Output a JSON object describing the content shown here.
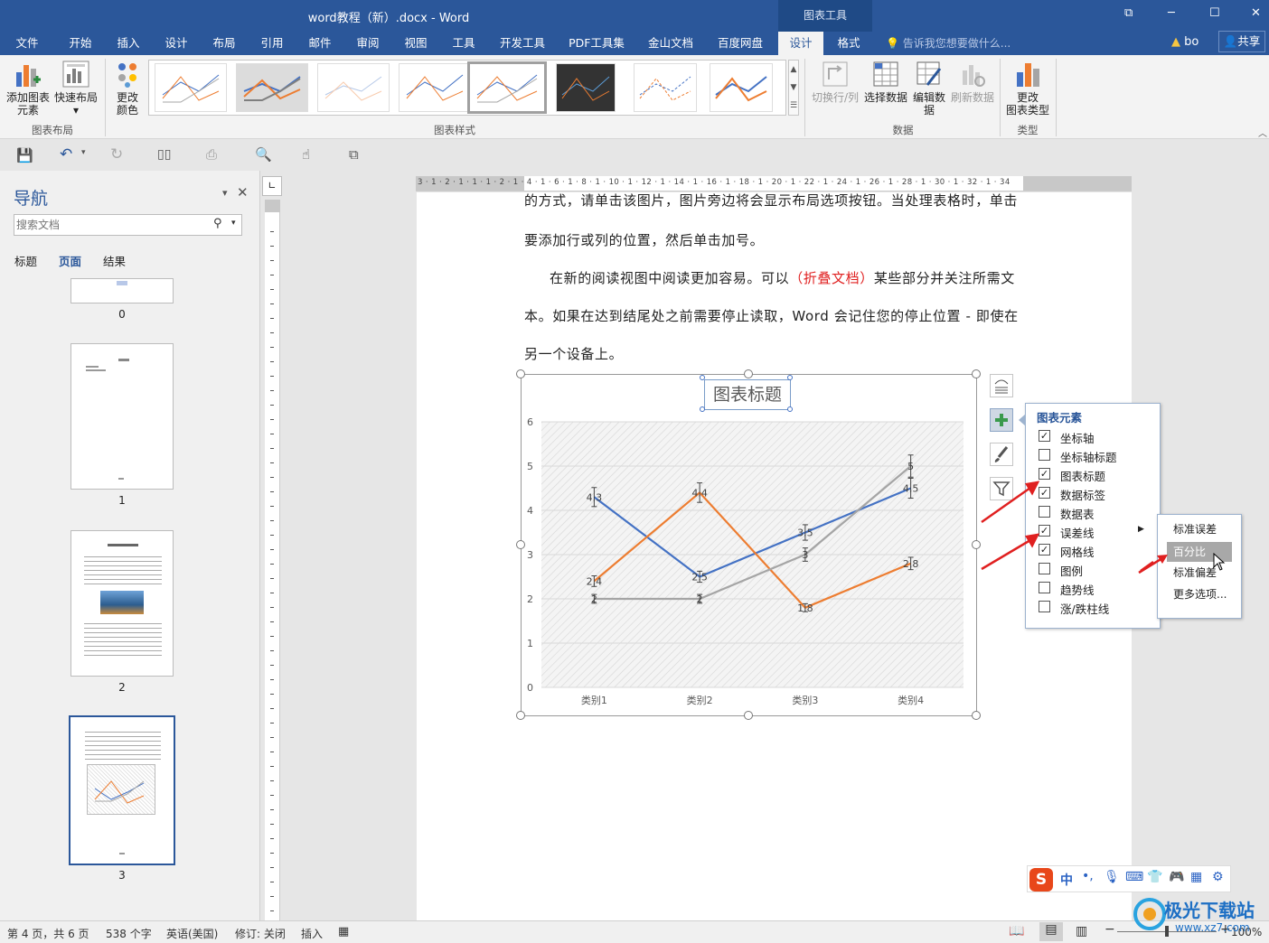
{
  "window": {
    "title": "word教程（新）.docx - Word",
    "chart_tools": "图表工具"
  },
  "menu": {
    "tabs": [
      "文件",
      "开始",
      "插入",
      "设计",
      "布局",
      "引用",
      "邮件",
      "审阅",
      "视图",
      "工具",
      "开发工具",
      "PDF工具集",
      "金山文档",
      "百度网盘",
      "设计",
      "格式"
    ],
    "tell_me": "告诉我您想要做什么...",
    "user": "bo",
    "share": "共享"
  },
  "ribbon": {
    "add_element": "添加图表\n元素",
    "quick_layout": "快速布局",
    "layout_group": "图表布局",
    "change_colors": "更改\n颜色",
    "styles_group": "图表样式",
    "switch_row_col": "切换行/列",
    "select_data": "选择数据",
    "edit_data": "编辑数\n据",
    "refresh_data": "刷新数据",
    "data_group": "数据",
    "change_type": "更改\n图表类型",
    "type_group": "类型"
  },
  "nav": {
    "title": "导航",
    "search_placeholder": "搜索文档",
    "tabs": [
      "标题",
      "页面",
      "结果"
    ],
    "pages": [
      "0",
      "1",
      "2",
      "3"
    ]
  },
  "ruler": {
    "h_ticks": "3 · 1 · 2 · 1 · 1 · 1 · 2 · 1 · 4 · 1 · 6 · 1 · 8 · 1 · 10 · 1 · 12 · 1 · 14 · 1 · 16 · 1 · 18 · 1 · 20 · 1 · 22 · 1 · 24 · 1 · 26 · 1 · 28 · 1 · 30 · 1 · 32 · 1 · 34"
  },
  "document": {
    "line1": "的方式，请单击该图片，图片旁边将会显示布局选项按钮。当处理表格时，单击",
    "line2": "要添加行或列的位置，然后单击加号。",
    "line3a": "在新的阅读视图中阅读更加容易。可以",
    "line3_link": "（折叠文档）",
    "line3b": "某些部分并关注所需文",
    "line4": "本。如果在达到结尾处之前需要停止读取，Word 会记住您的停止位置 - 即使在",
    "line5": "另一个设备上。"
  },
  "chart_elements": {
    "title": "图表元素",
    "items": [
      {
        "label": "坐标轴",
        "checked": true
      },
      {
        "label": "坐标轴标题",
        "checked": false
      },
      {
        "label": "图表标题",
        "checked": true
      },
      {
        "label": "数据标签",
        "checked": true
      },
      {
        "label": "数据表",
        "checked": false
      },
      {
        "label": "误差线",
        "checked": true
      },
      {
        "label": "网格线",
        "checked": true
      },
      {
        "label": "图例",
        "checked": false
      },
      {
        "label": "趋势线",
        "checked": false
      },
      {
        "label": "涨/跌柱线",
        "checked": false
      }
    ],
    "submenu": [
      "标准误差",
      "百分比",
      "标准偏差",
      "更多选项..."
    ],
    "submenu_highlighted": "百分比"
  },
  "chart_data": {
    "type": "line",
    "title": "图表标题",
    "categories": [
      "类别1",
      "类别2",
      "类别3",
      "类别4"
    ],
    "series": [
      {
        "values": [
          4.3,
          2.5,
          3.5,
          4.5
        ],
        "color": "#4472c4"
      },
      {
        "values": [
          2.4,
          4.4,
          1.8,
          2.8
        ],
        "color": "#ed7d31"
      },
      {
        "values": [
          2,
          2,
          3,
          5
        ],
        "color": "#a5a5a5"
      }
    ],
    "data_labels": [
      [
        "4.3",
        "2.5",
        "3.5",
        "4.5"
      ],
      [
        "2.4",
        "4.4",
        "1.8",
        "2.8"
      ],
      [
        "2",
        "2",
        "3",
        "5"
      ]
    ],
    "ylim": [
      0,
      6
    ],
    "yticks": [
      "0",
      "1",
      "2",
      "3",
      "4",
      "5",
      "6"
    ],
    "grid": true,
    "error_bars": true,
    "legend": "none"
  },
  "status": {
    "page": "第 4 页，共 6 页",
    "words": "538 个字",
    "language": "英语(美国)",
    "track": "修订: 关闭",
    "mode": "插入",
    "zoom": "100%"
  },
  "ime": {
    "label": "中"
  },
  "watermark": {
    "text": "极光下载站",
    "url": "www.xz7.com"
  }
}
